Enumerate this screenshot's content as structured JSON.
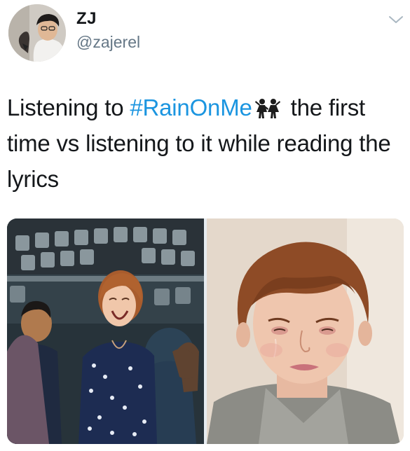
{
  "user": {
    "display_name": "ZJ",
    "handle": "@zajerel",
    "avatar_icon": "profile-photo"
  },
  "tweet": {
    "text_before": "Listening to ",
    "hashtag": "#RainOnMe",
    "emoji_icon": "women-dancing-emoji",
    "text_after": " the first time vs listening to it while reading the lyrics"
  },
  "menu_icon": "chevron-down-icon",
  "media": [
    {
      "icon": "laughing-woman-in-auditorium-photo"
    },
    {
      "icon": "crying-woman-photo"
    }
  ],
  "colors": {
    "text": "#14171a",
    "handle": "#657786",
    "hashtag": "#1b95e0",
    "chevron": "#aab8c2"
  }
}
